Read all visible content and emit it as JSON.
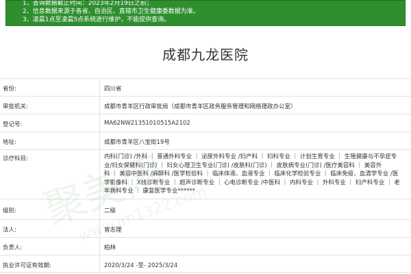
{
  "notice": {
    "lines": [
      "1、查询数据截止时间：2023年2月19日之前；",
      "2、信息数据来源于各省、自治区、直辖市卫生健康委数据为准。",
      "3、凌晨1点至凌晨5点系统进行维护，不能提供查询。"
    ]
  },
  "hospital_name": "成都九龙医院",
  "fields": {
    "province_label": "省份:",
    "province_value": "四川省",
    "authority_label": "审批机关:",
    "authority_value": "成都市青羊区行政审批局（成都市青羊区政务服务管理和网络理政办公室）",
    "registration_label": "登记号:",
    "registration_value": "MA62NW21351010515A2102",
    "address_label": "地址:",
    "address_value": "成都市青羊区八宝街19号",
    "departments_label": "诊疗科目:",
    "departments_lines": [
      "内科(门诊) /外科 ｜ 普通外科专业 ｜ 泌尿外科专业 /妇产科 ｜ 妇科专业 ｜ 计划生育专业 ｜ 生殖健康与不孕症专",
      "业/妇女保健科(门诊) ｜ 妇女心理卫生专业(门诊) /皮肤科(门诊) ｜ 皮肤病专业(门诊) /医疗美容科 ｜ 美容外",
      "科 ｜ 美容中医科 /麻醉科 /医学检验科 ｜ 临床体液、血液专业 ｜ 临床化学检验专业 ｜ 临床免疫、血清学专业 /医",
      "学影像科 ｜ X线诊断专业 ｜ 超声诊断专业 ｜ 心电诊断专业 /中医科 ｜ 内科专业 ｜ 外科专业 ｜ 妇产科专业 ｜ 老",
      "年病科专业 ｜ 康复医学专业******"
    ],
    "level_label": "级别:",
    "level_value": "二级",
    "legal_label": "法人:",
    "legal_value": "曾志理",
    "head_label": "负责人:",
    "head_value": "柏林",
    "license_label": "执业许可证有效期:",
    "license_value": "2020/3/24 -至- 2025/3/24"
  },
  "watermark": {
    "text": "聚美网",
    "url": "www.jm1322.com"
  },
  "colors": {
    "notice_bg": "#2f8f2f",
    "border": "#e2e2e2",
    "text": "#333333"
  }
}
